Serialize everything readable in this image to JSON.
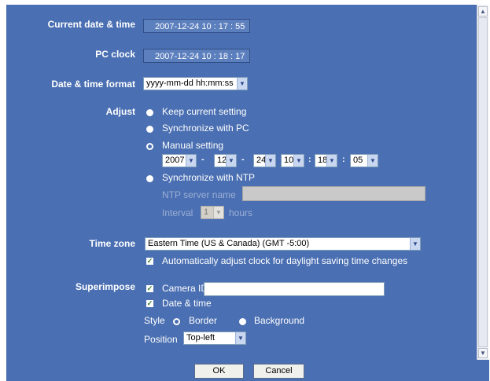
{
  "form": {
    "current_label": "Current date & time",
    "current_value": "2007-12-24  10 : 17 : 55",
    "pc_label": "PC clock",
    "pc_value": "2007-12-24  10 : 18 : 17",
    "format_label": "Date & time format",
    "format_value": "yyyy-mm-dd hh:mm:ss",
    "adjust_label": "Adjust",
    "adjust_options": [
      "Keep current setting",
      "Synchronize with PC",
      "Manual setting",
      "Synchronize with NTP"
    ],
    "adjust_selected": "Manual setting",
    "manual": {
      "year": "2007",
      "month": "12",
      "day": "24",
      "hour": "10",
      "minute": "18",
      "second": "05",
      "date_sep": "-",
      "time_sep": ":"
    },
    "ntp_server_label": "NTP server name",
    "ntp_server_value": "",
    "interval_label": "Interval",
    "interval_value": "1",
    "interval_unit": "hours",
    "timezone_label": "Time zone",
    "timezone_value": "Eastern Time (US & Canada) (GMT -5:00)",
    "dst_label": "Automatically adjust clock for daylight saving time changes",
    "dst_checked": true,
    "superimpose_label": "Superimpose",
    "camera_id_label": "Camera ID",
    "camera_id_checked": true,
    "camera_id_value": "",
    "datetime_label": "Date & time",
    "datetime_checked": true,
    "style_label": "Style",
    "style_options": [
      "Border",
      "Background"
    ],
    "style_selected": "Border",
    "position_label": "Position",
    "position_value": "Top-left"
  },
  "buttons": {
    "ok": "OK",
    "cancel": "Cancel"
  },
  "icons": {
    "dropdown": "chevron-down-icon",
    "scroll_up": "arrow-up-icon",
    "scroll_down": "arrow-down-icon",
    "check": "checkmark-icon"
  },
  "colors": {
    "panel_bg": "#4a6fb2",
    "label_text": "#ffffff",
    "check_mark": "#3b7d25"
  }
}
